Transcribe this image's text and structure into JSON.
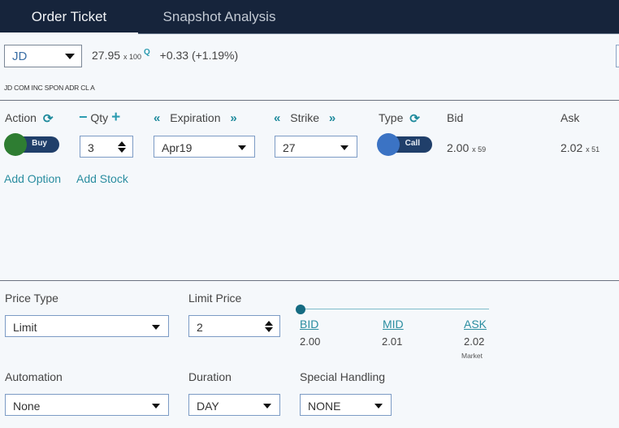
{
  "tabs": [
    {
      "label": "Order Ticket",
      "active": true
    },
    {
      "label": "Snapshot Analysis",
      "active": false
    }
  ],
  "quote": {
    "symbol": "JD",
    "last": "27.95",
    "size": "x 100",
    "exchange": "Q",
    "change": "+0.33 (+1.19%)",
    "description": "JD COM INC SPON ADR CL A"
  },
  "leg": {
    "labels": {
      "action": "Action",
      "qty": "Qty",
      "expiration": "Expiration",
      "strike": "Strike",
      "type": "Type",
      "bid": "Bid",
      "ask": "Ask"
    },
    "icons": {
      "refresh": "⟳",
      "minus": "−",
      "plus": "+",
      "prev": "«",
      "next": "»"
    },
    "action": "Buy",
    "qty": "3",
    "expiration": "Apr19",
    "strike": "27",
    "type": "Call",
    "bid": "2.00",
    "bid_size": "x 59",
    "ask": "2.02",
    "ask_size": "x 51"
  },
  "links": {
    "add_option": "Add Option",
    "add_stock": "Add Stock"
  },
  "order": {
    "price_type_label": "Price Type",
    "price_type": "Limit",
    "limit_price_label": "Limit Price",
    "limit_price": "2",
    "price_slider": {
      "bid_label": "BID",
      "bid": "2.00",
      "mid_label": "MID",
      "mid": "2.01",
      "ask_label": "ASK",
      "ask": "2.02",
      "ask_note": "Market",
      "position": 0
    },
    "automation_label": "Automation",
    "automation": "None",
    "duration_label": "Duration",
    "duration": "DAY",
    "special_handling_label": "Special Handling",
    "special_handling": "NONE"
  },
  "colors": {
    "header_bg": "#16243b",
    "accent_teal": "#2a8da0",
    "buy_green": "#2e7d32",
    "call_blue": "#3b73c4",
    "toggle_navy": "#203f6a"
  }
}
